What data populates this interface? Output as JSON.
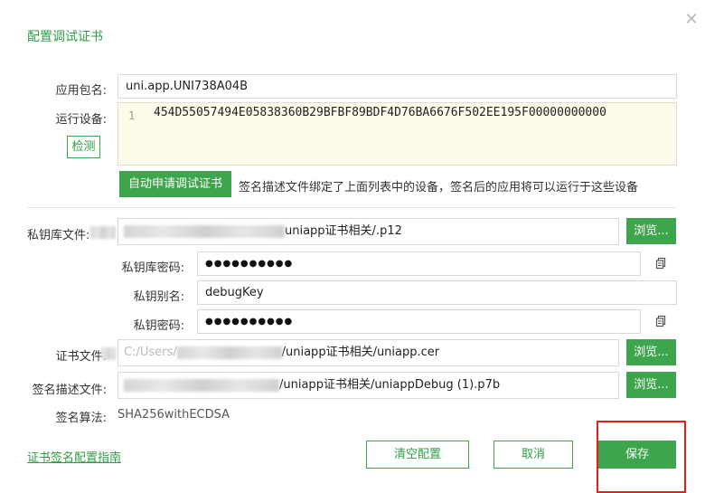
{
  "dialog": {
    "title": "配置调试证书",
    "close_icon": "close-icon"
  },
  "form": {
    "package_label": "应用包名:",
    "package_value": "uni.app.UNI738A04B",
    "device_label": "运行设备:",
    "detect_button": "检测",
    "device_line_number": "1",
    "device_id": "454D55057494E05838360B29BFBF89BDF4D76BA6676F502EE195F00000000000",
    "apply_button": "自动申请调试证书",
    "apply_hint": "签名描述文件绑定了上面列表中的设备，签名后的应用将可以运行于这些设备",
    "keystore_label": "私钥库文件:",
    "keystore_value": "uniapp证书相关/.p12",
    "keystore_pwd_label": "私钥库密码:",
    "keystore_pwd_value": "●●●●●●●●●●",
    "alias_label": "私钥别名:",
    "alias_value": "debugKey",
    "key_pwd_label": "私钥密码:",
    "key_pwd_value": "●●●●●●●●●●",
    "cert_label": "证书文件:",
    "cert_prefix": "C:/Users/",
    "cert_value": "/uniapp证书相关/uniapp.cer",
    "profile_label": "签名描述文件:",
    "profile_value": "/uniapp证书相关/uniappDebug (1).p7b",
    "algo_label": "签名算法:",
    "algo_value": "SHA256withECDSA",
    "browse_label": "浏览..."
  },
  "footer": {
    "guide_link": "证书签名配置指南",
    "clear_button": "清空配置",
    "cancel_button": "取消",
    "save_button": "保存"
  },
  "colors": {
    "accent": "#3da54b",
    "annotation": "#e02020"
  }
}
